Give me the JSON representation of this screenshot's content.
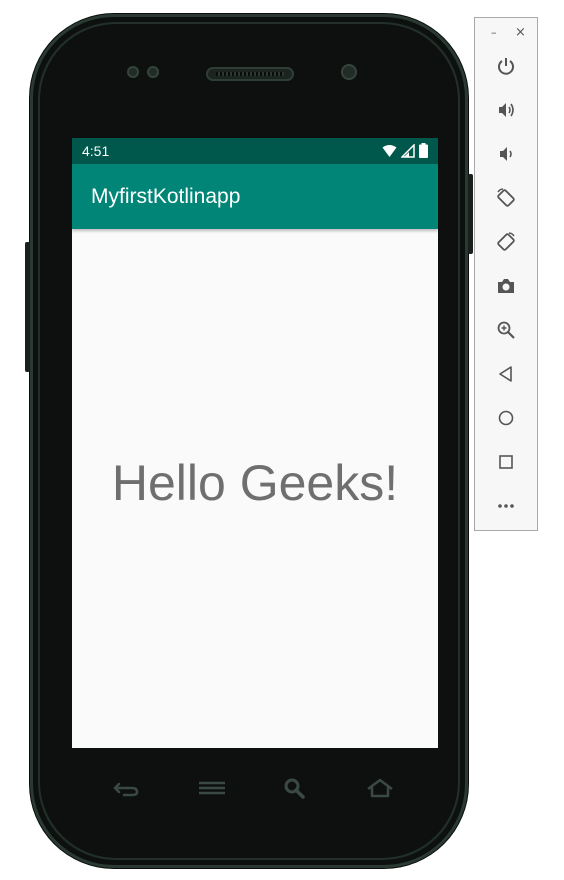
{
  "status_bar": {
    "time": "4:51",
    "icons": [
      "wifi-icon",
      "signal-icon",
      "battery-icon"
    ]
  },
  "app_bar": {
    "title": "MyfirstKotlinapp"
  },
  "content": {
    "text": "Hello Geeks!"
  },
  "hardware_keys": [
    "back-icon",
    "menu-icon",
    "search-icon",
    "home-icon"
  ],
  "emulator_toolbar": {
    "window_controls": {
      "minimize": "–",
      "close": "×"
    },
    "buttons": [
      "power-icon",
      "volume-up-icon",
      "volume-down-icon",
      "rotate-left-icon",
      "rotate-right-icon",
      "camera-icon",
      "zoom-icon",
      "back-icon",
      "home-icon",
      "overview-icon",
      "more-icon"
    ]
  },
  "colors": {
    "status_bar": "#00574b",
    "app_bar": "#008577",
    "screen_background": "#fafafa",
    "content_text": "#6f6f6f"
  }
}
